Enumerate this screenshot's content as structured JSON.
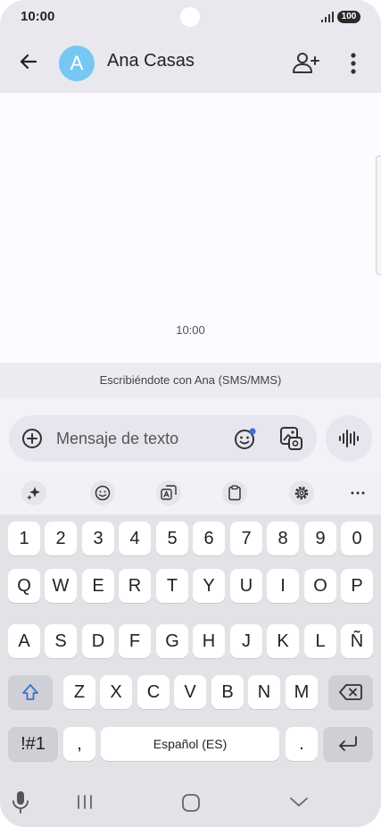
{
  "status": {
    "time": "10:00",
    "battery": "100"
  },
  "header": {
    "avatar_letter": "A",
    "contact_name": "Ana Casas"
  },
  "conversation": {
    "message_time": "10:00",
    "info_text": "Escribiéndote con Ana (SMS/MMS)"
  },
  "composer": {
    "placeholder": "Mensaje de texto"
  },
  "keyboard": {
    "row_numbers": [
      "1",
      "2",
      "3",
      "4",
      "5",
      "6",
      "7",
      "8",
      "9",
      "0"
    ],
    "row_q": [
      "Q",
      "W",
      "E",
      "R",
      "T",
      "Y",
      "U",
      "I",
      "O",
      "P"
    ],
    "row_a": [
      "A",
      "S",
      "D",
      "F",
      "G",
      "H",
      "J",
      "K",
      "L",
      "Ñ"
    ],
    "row_z": [
      "Z",
      "X",
      "C",
      "V",
      "B",
      "N",
      "M"
    ],
    "symbols_label": "!#1",
    "comma": ",",
    "space_label": "Español (ES)",
    "period": "."
  },
  "colors": {
    "avatar": "#76c8f2",
    "accent": "#3b6fd8"
  }
}
